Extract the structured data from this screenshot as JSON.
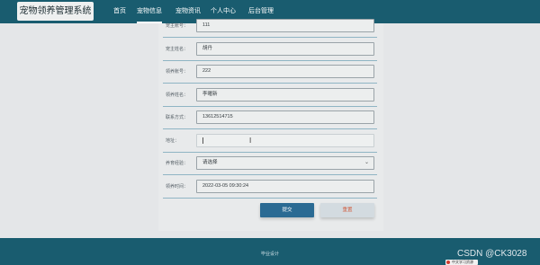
{
  "header": {
    "logo_text": "宠物领养管理系统",
    "nav": [
      {
        "label": "首页"
      },
      {
        "label": "宠物信息",
        "active": true
      },
      {
        "label": "宠物资讯"
      },
      {
        "label": "个人中心"
      },
      {
        "label": "后台管理"
      }
    ]
  },
  "form": {
    "fields": [
      {
        "label": "宠主账号：",
        "value": "111"
      },
      {
        "label": "宠主姓名：",
        "value": "胡丹"
      },
      {
        "label": "领养账号：",
        "value": "222"
      },
      {
        "label": "领养姓名：",
        "value": "李曜新"
      },
      {
        "label": "联系方式：",
        "value": "13612514715"
      },
      {
        "label": "地址：",
        "value": ""
      },
      {
        "label": "养育经验：",
        "value": "请选择"
      },
      {
        "label": "领养时间：",
        "value": "2022-03-05 09:30:24"
      }
    ],
    "submit_label": "提交",
    "reset_label": "重置"
  },
  "footer": {
    "text": "毕业设计"
  },
  "watermark": {
    "text": "CSDN @CK3028",
    "badge_text": "中文学习资源"
  },
  "colors": {
    "header_bg": "#195c6f",
    "page_bg": "#e4e6e8",
    "submit_bg": "#2a6a93",
    "reset_text": "#d05a3c"
  },
  "icons": {
    "select_arrow": "chevron-down-icon",
    "mouse_cursor": "text-cursor-icon"
  }
}
